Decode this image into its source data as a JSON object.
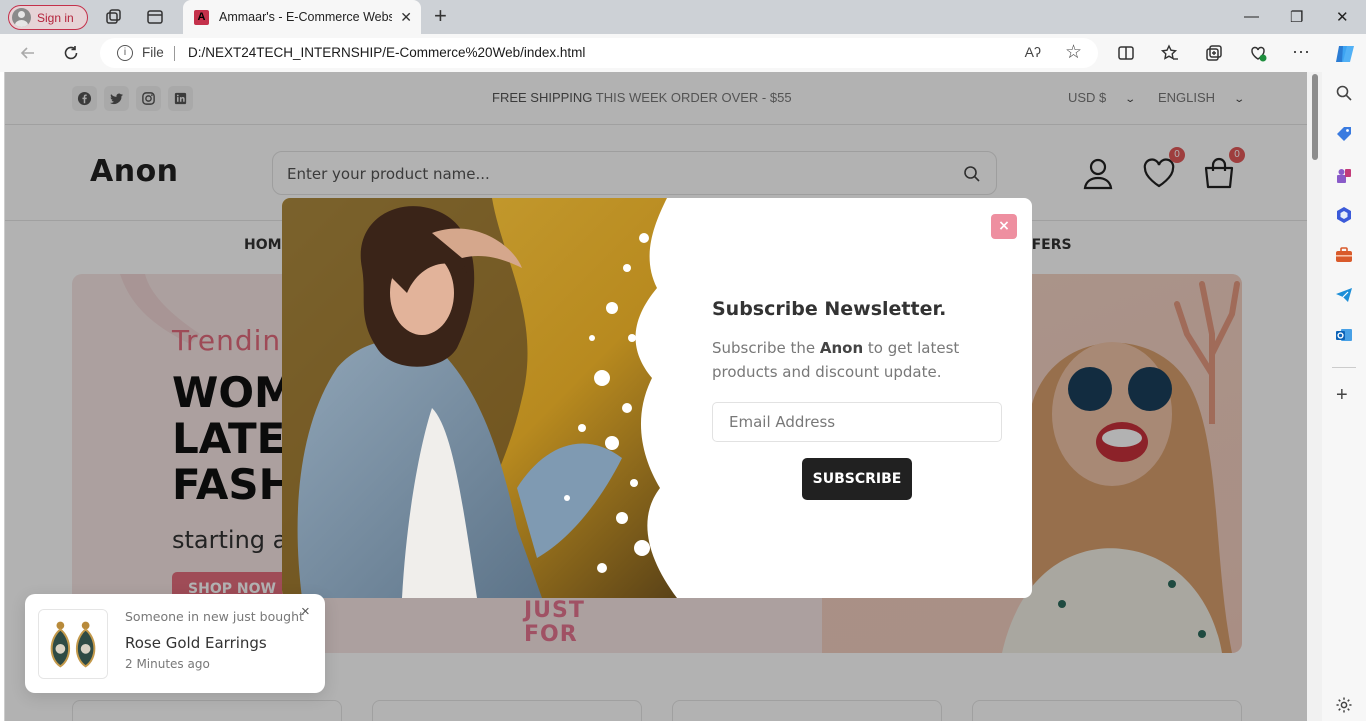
{
  "browser": {
    "signin_label": "Sign in",
    "tab_title": "Ammaar's - E-Commerce Website",
    "omnibox_scheme": "File",
    "url": "D:/NEXT24TECH_INTERNSHIP/E-Commerce%20Web/index.html",
    "read_aloud": "Aʔ"
  },
  "topbar": {
    "shipping_bold": "Free Shipping",
    "shipping_rest": " This Week Order Over - $55",
    "currency": "USD $",
    "language": "ENGLISH"
  },
  "header": {
    "logo": "Anon",
    "search_placeholder": "Enter your product name...",
    "wishlist_count": "0",
    "cart_count": "0"
  },
  "menu": {
    "home": "Home",
    "offers_fragment": "ffers"
  },
  "hero": {
    "subtitle": "Trendin",
    "title_lines": [
      "WOM",
      "LATE",
      "FASH"
    ],
    "price_text": "starting a",
    "cta": "Shop Now",
    "sticker": "JUST FOR"
  },
  "modal": {
    "title": "Subscribe Newsletter.",
    "desc_pre": "Subscribe the ",
    "desc_brand": "Anon",
    "desc_post": " to get latest products and discount update.",
    "email_placeholder": "Email Address",
    "button": "Subscribe",
    "close": "×"
  },
  "toast": {
    "subtitle": "Someone in new just bought",
    "product": "Rose Gold Earrings",
    "time": "2 Minutes ago",
    "close": "×"
  }
}
